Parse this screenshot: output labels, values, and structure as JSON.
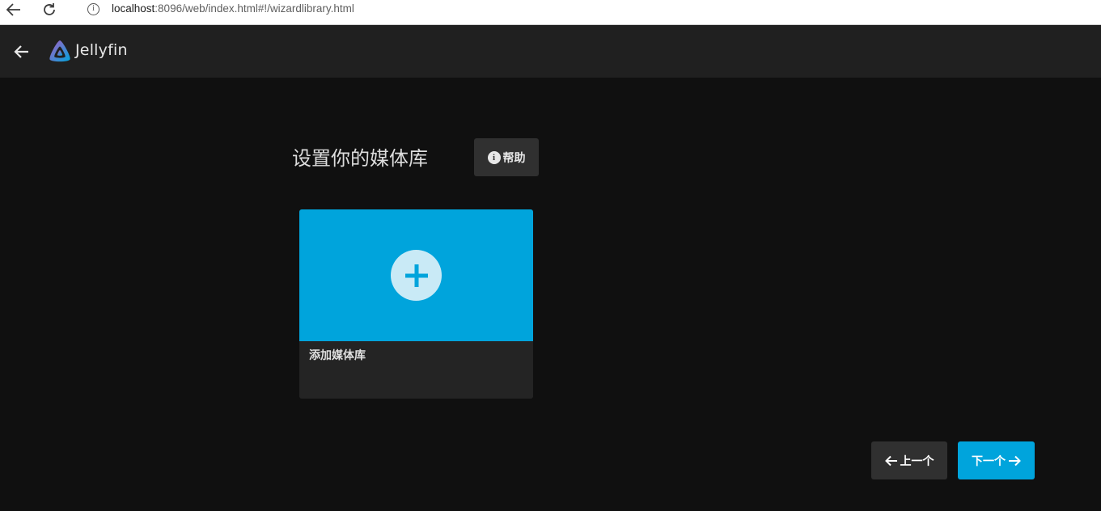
{
  "browser": {
    "url_host": "localhost",
    "url_rest": ":8096/web/index.html#!/wizardlibrary.html",
    "info_glyph": "i",
    "icons": [
      "back-arrow-icon",
      "reload-icon",
      "info-icon"
    ]
  },
  "header": {
    "app_name": "Jellyfin",
    "icons": [
      "back-arrow-icon",
      "jellyfin-logo-icon"
    ],
    "background": "#202020"
  },
  "main": {
    "title": "设置你的媒体库",
    "help_label": "帮助",
    "help_icon_glyph": "i",
    "add_library_label": "添加媒体库",
    "accent_color": "#00a4dc",
    "background": "#101010"
  },
  "footer": {
    "prev_label": "上一个",
    "next_label": "下一个"
  }
}
